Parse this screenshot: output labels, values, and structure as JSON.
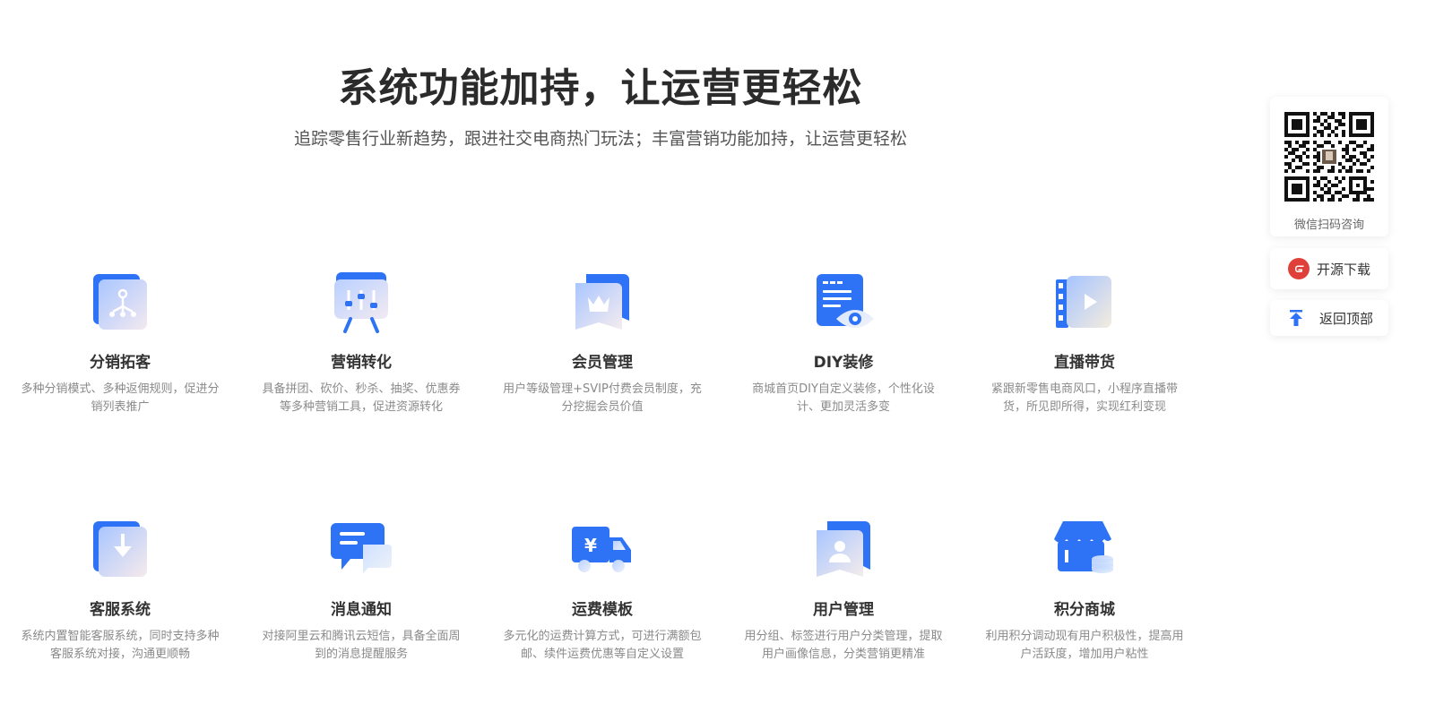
{
  "hero": {
    "title": "系统功能加持，让运营更轻松",
    "subtitle": "追踪零售行业新趋势，跟进社交电商热门玩法；丰富营销功能加持，让运营更轻松"
  },
  "colors": {
    "brand_blue": "#2e73f5",
    "light_blue": "#cfe0ff",
    "title_dark": "#2b2b2b",
    "desc_gray": "#8a8a8a",
    "gitee_red": "#e0403a"
  },
  "features": [
    {
      "title": "分销拓客",
      "desc": "多种分销模式、多种返佣规则，促进分销列表推广",
      "icon": "distribution-tree-icon"
    },
    {
      "title": "营销转化",
      "desc": "具备拼团、砍价、秒杀、抽奖、优惠券等多种营销工具，促进资源转化",
      "icon": "marketing-board-icon"
    },
    {
      "title": "会员管理",
      "desc": "用户等级管理+SVIP付费会员制度，充分挖掘会员价值",
      "icon": "member-crown-icon"
    },
    {
      "title": "DIY装修",
      "desc": "商城首页DIY自定义装修，个性化设计、更加灵活多变",
      "icon": "diy-eye-icon"
    },
    {
      "title": "直播带货",
      "desc": "紧跟新零售电商风口，小程序直播带货，所见即所得，实现红利变现",
      "icon": "live-video-icon"
    },
    {
      "title": "客服系统",
      "desc": "系统内置智能客服系统，同时支持多种客服系统对接，沟通更顺畅",
      "icon": "customer-service-download-icon"
    },
    {
      "title": "消息通知",
      "desc": "对接阿里云和腾讯云短信，具备全面周到的消息提醒服务",
      "icon": "message-chat-icon"
    },
    {
      "title": "运费模板",
      "desc": "多元化的运费计算方式，可进行满额包邮、续件运费优惠等自定义设置",
      "icon": "shipping-truck-icon"
    },
    {
      "title": "用户管理",
      "desc": "用分组、标签进行用户分类管理，提取用户画像信息，分类营销更精准",
      "icon": "user-card-icon"
    },
    {
      "title": "积分商城",
      "desc": "利用积分调动现有用户积极性，提高用户活跃度，增加用户粘性",
      "icon": "points-shop-icon"
    }
  ],
  "sidebar": {
    "qr_label": "微信扫码咨询",
    "qr_icon": "wechat-qr-code",
    "download_label": "开源下载",
    "download_icon": "gitee-logo-icon",
    "top_label": "返回顶部",
    "top_icon": "arrow-up-icon"
  }
}
